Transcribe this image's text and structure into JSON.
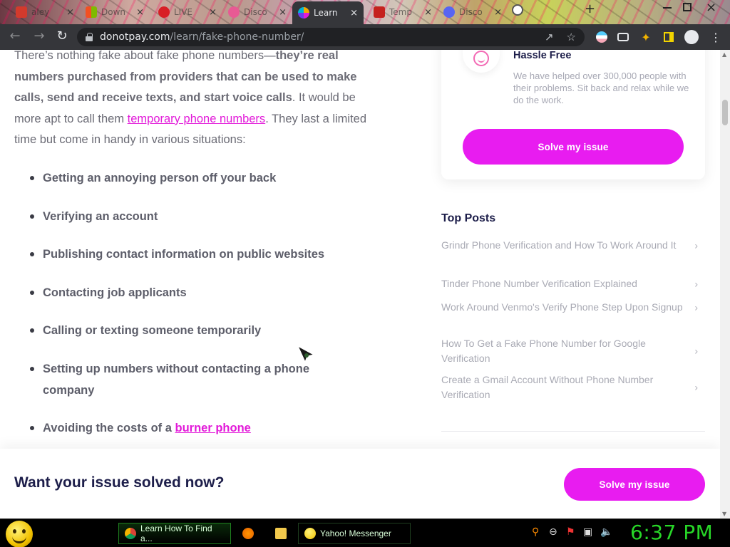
{
  "browser": {
    "tabs": [
      {
        "label": "aley",
        "favicon_color": "#d33a2c",
        "active": false
      },
      {
        "label": "Down",
        "favicon_color": "#2a7ad8",
        "active": false
      },
      {
        "label": "LIVE",
        "favicon_color": "#d81f26",
        "active": false
      },
      {
        "label": "Disco",
        "favicon_color": "#e85a94",
        "active": false
      },
      {
        "label": "Learn",
        "favicon_color": "#f2a900",
        "active": true
      },
      {
        "label": "Temp",
        "favicon_color": "#c5221f",
        "active": false
      },
      {
        "label": "Disco",
        "favicon_color": "#5865f2",
        "active": false
      }
    ],
    "close_glyph": "×",
    "new_tab_glyph": "+",
    "url_host": "donotpay.com",
    "url_path": "/learn/fake-phone-number/"
  },
  "article": {
    "intro_plain_1": "There’s nothing fake about fake phone numbers—",
    "intro_bold": "they’re real numbers purchased from providers that can be used to make calls, send and receive texts, and start voice calls",
    "intro_plain_2": ". It would be more apt to call them ",
    "intro_link": "temporary phone numbers",
    "intro_plain_3": ". They last a limited time but come in handy in various situations:",
    "bullets": [
      "Getting an annoying person off your back",
      "Verifying an account",
      "Publishing contact information on public websites",
      "Contacting job applicants",
      "Calling or texting someone temporarily",
      "Setting up numbers without contacting a phone company"
    ],
    "last_bullet_prefix": "Avoiding the costs of a ",
    "last_bullet_link": "burner phone"
  },
  "sidebar": {
    "card_title": "Hassle Free",
    "card_text": "We have helped over 300,000 people with their problems. Sit back and relax while we do the work.",
    "card_button": "Solve my issue",
    "top_posts_title": "Top Posts",
    "posts": [
      "Grindr Phone Verification and How To Work Around It",
      "Tinder Phone Number Verification Explained",
      "Work Around Venmo's Verify Phone Step Upon Signup",
      "How To Get a Fake Phone Number for Google Verification",
      "Create a Gmail Account Without Phone Number Verification"
    ]
  },
  "cta": {
    "title": "Want your issue solved now?",
    "button": "Solve my issue"
  },
  "taskbar": {
    "items": [
      {
        "label": "Learn How To Find a..."
      },
      {
        "label": "Yahoo! Messenger"
      }
    ],
    "clock": "6:37 PM"
  },
  "colors": {
    "accent": "#e81cf0",
    "link": "#e21ad9",
    "heading": "#1d1e4a",
    "clock": "#27d627"
  }
}
